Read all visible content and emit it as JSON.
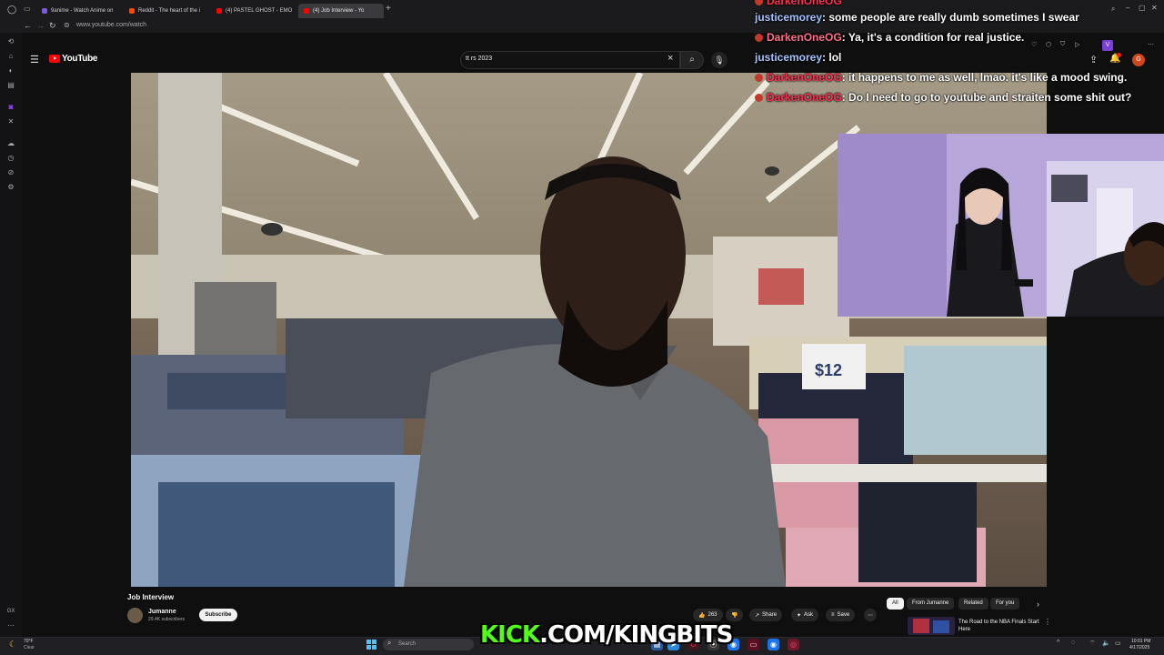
{
  "browser": {
    "tabs": [
      {
        "label": "9anime - Watch Anime on",
        "favicon_color": "#7b5cd6"
      },
      {
        "label": "Reddit - The heart of the i",
        "favicon_color": "#ff4500"
      },
      {
        "label": "(4) PASTEL GHOST - EMO",
        "favicon_color": "#ff0000"
      },
      {
        "label": "(4) Job Interview - Yo",
        "favicon_color": "#ff0000"
      }
    ],
    "url": "www.youtube.com/watch"
  },
  "youtube": {
    "logo_text": "YouTube",
    "search_value": "tt rs 2023",
    "avatar_initial": "G"
  },
  "video": {
    "title": "Job Interview",
    "channel_name": "Jumanne",
    "channel_subs": "29.4K subscribers",
    "subscribe_label": "Subscribe",
    "like_count": "263",
    "share_label": "Share",
    "ask_label": "Ask",
    "save_label": "Save",
    "price_sign": "$12"
  },
  "recommendations": {
    "chips": [
      "All",
      "From Jumanne",
      "Related",
      "For you"
    ],
    "first_title": "The Road to the NBA Finals Start Here"
  },
  "chat": {
    "messages": [
      {
        "user": "justicemorey",
        "text": ": some people are really dumb sometimes I swear",
        "user_color": "#9ec3ff",
        "badge": false
      },
      {
        "user": "DarkenOneOG",
        "text": ": Ya, it's a condition for real justice.",
        "user_color": "#ff6b8a",
        "badge": true
      },
      {
        "user": "justicemorey",
        "text": ": lol",
        "user_color": "#9ec3ff",
        "badge": false
      },
      {
        "user": "DarkenOneOG",
        "text": ": it happens to me as well, lmao. it's like a mood swing.",
        "user_color": "#ff2f50",
        "badge": true
      },
      {
        "user": "DarkenOneOG",
        "text": ": Do I need to go to youtube and straiten some shit out?",
        "user_color": "#ff2f50",
        "badge": true
      }
    ]
  },
  "overlay": {
    "kick_k": "KICK",
    "kick_rest": ".COM/KINGBITS"
  },
  "taskbar": {
    "weather_temp": "70°F",
    "weather_desc": "Clear",
    "search_placeholder": "Search",
    "time": "10:01 PM",
    "date": "4/17/2025"
  }
}
